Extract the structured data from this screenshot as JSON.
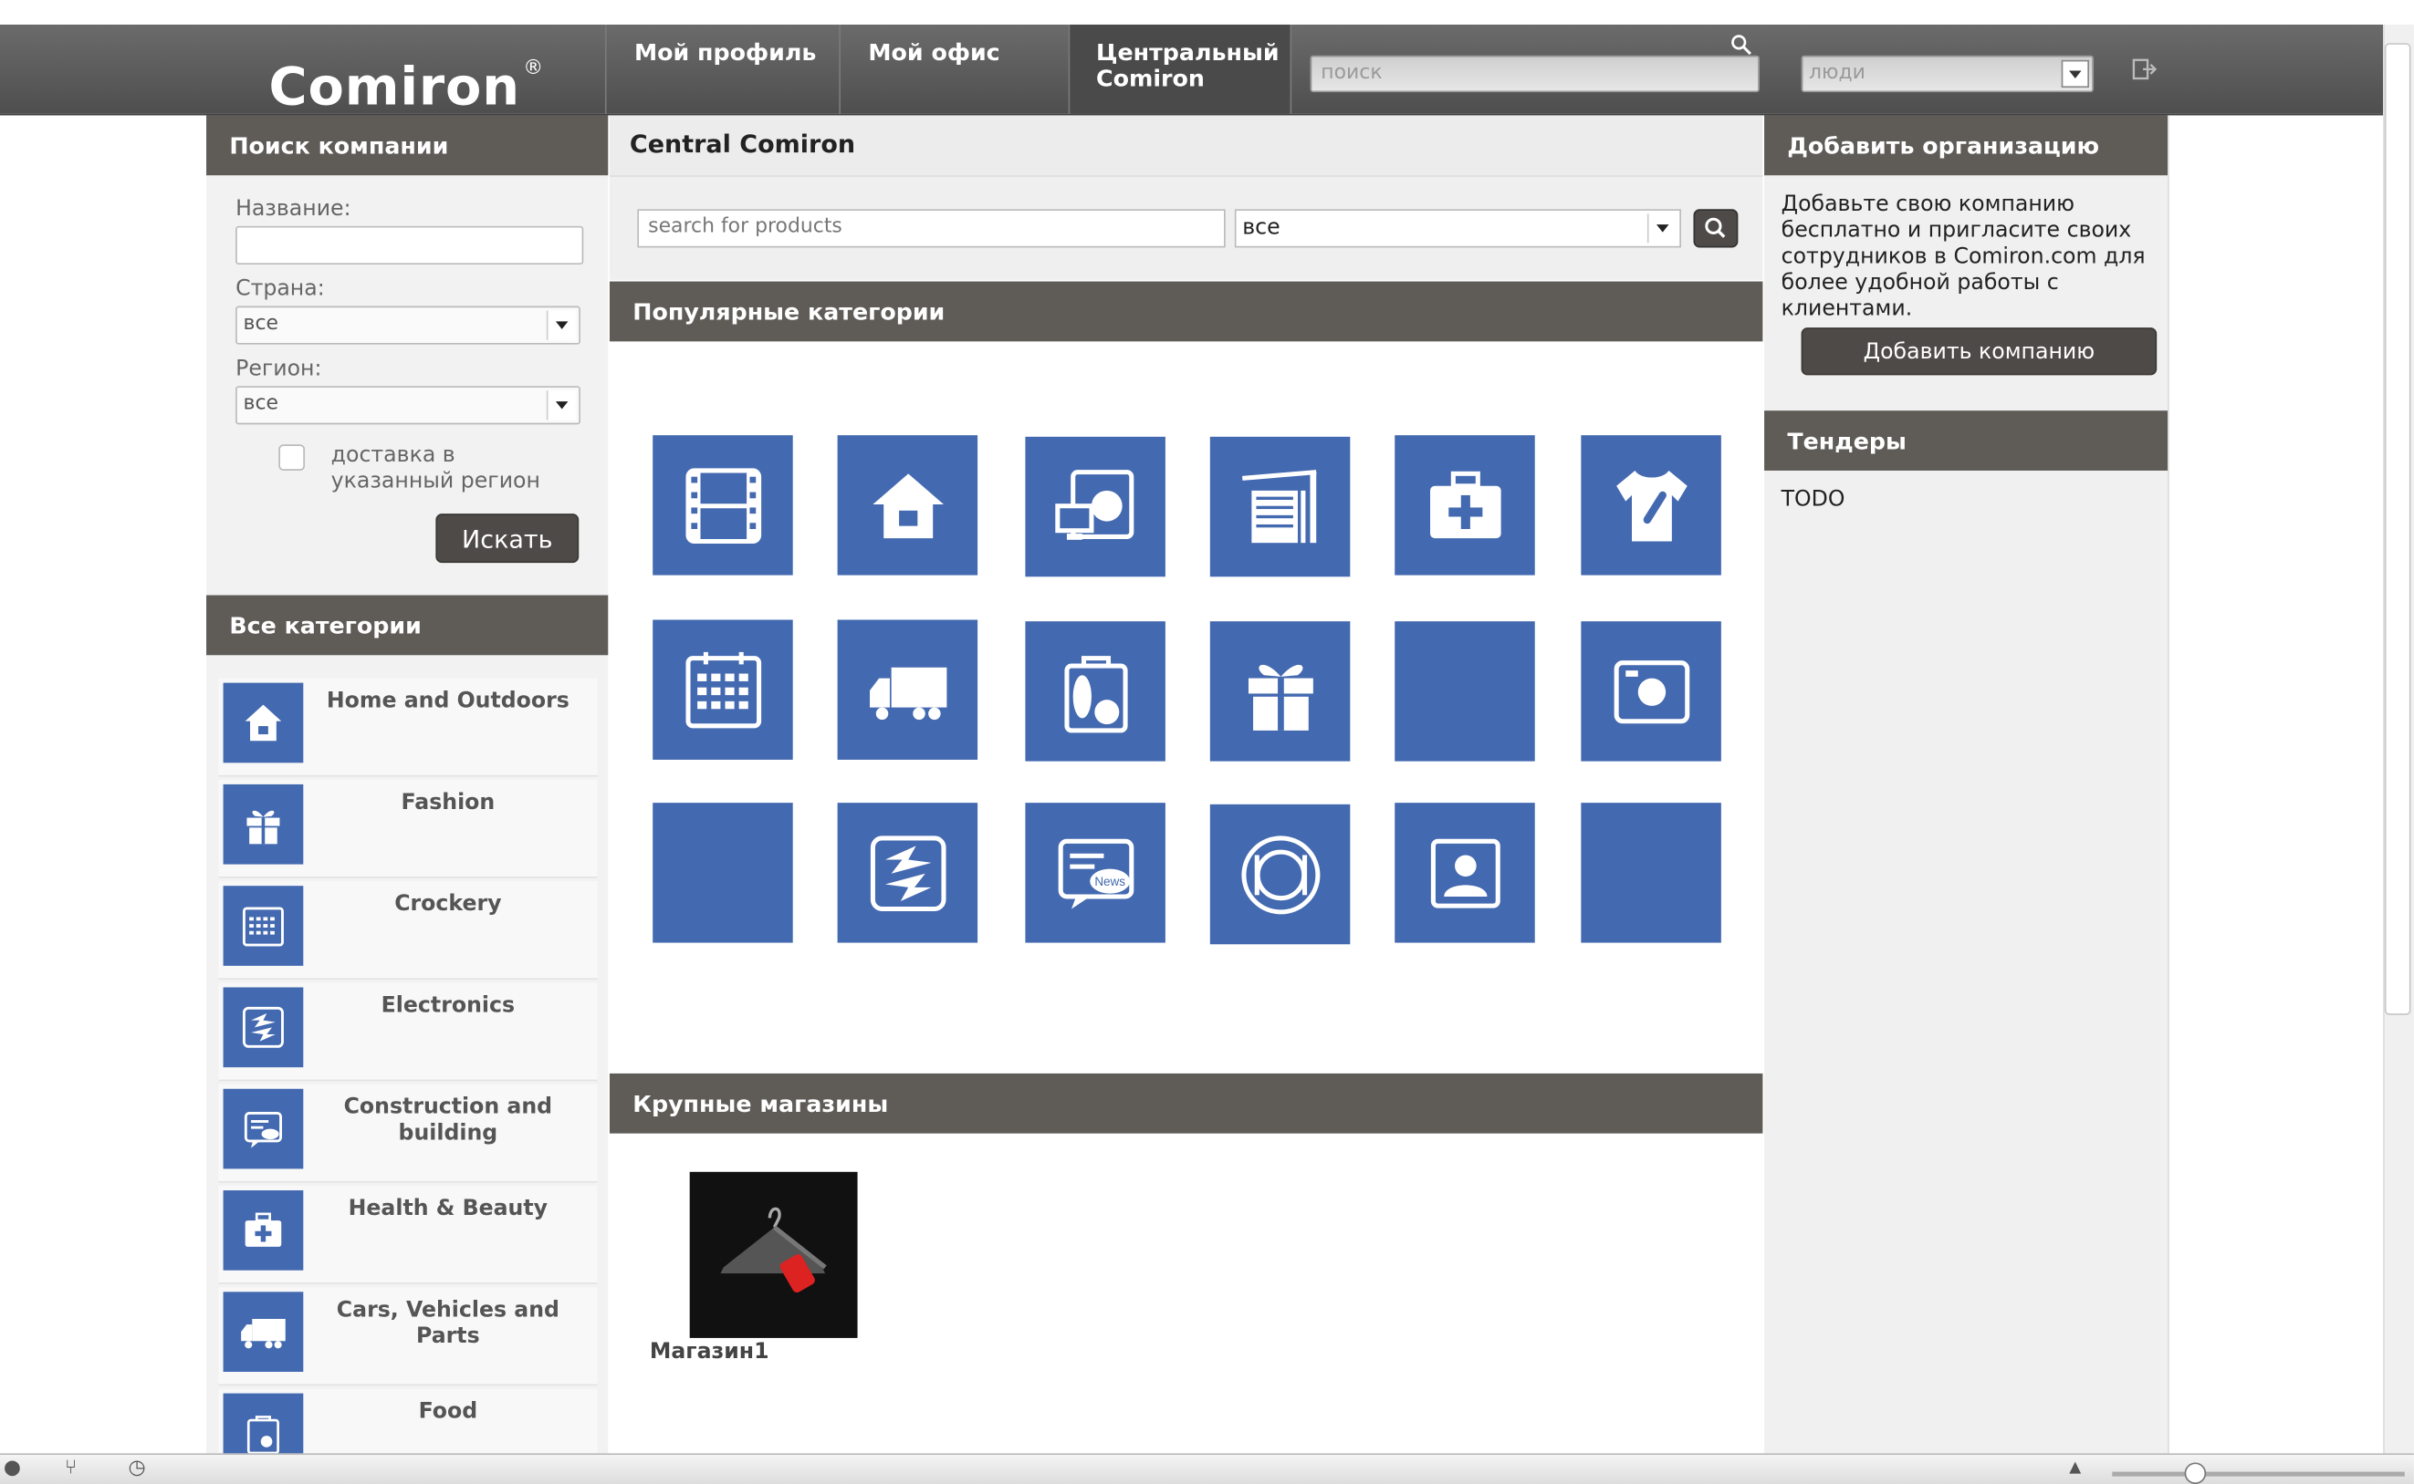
{
  "header": {
    "logo": "Comiron",
    "logo_mark": "®",
    "nav": [
      "Мой профиль",
      "Мой офис",
      "Центральный Comiron"
    ],
    "search_placeholder": "поиск",
    "people_select": "люди"
  },
  "left": {
    "search_title": "Поиск компании",
    "name_label": "Название:",
    "country_label": "Страна:",
    "country_value": "все",
    "region_label": "Регион:",
    "region_value": "все",
    "delivery_label": "доставка в указанный регион",
    "search_button": "Искать",
    "categories_title": "Все категории",
    "categories": [
      {
        "label": "Home and Outdoors",
        "icon": "house-icon"
      },
      {
        "label": "Fashion",
        "icon": "gift-icon"
      },
      {
        "label": "Crockery",
        "icon": "calendar-icon"
      },
      {
        "label": "Electronics",
        "icon": "recycle-icon"
      },
      {
        "label": "Construction and building",
        "icon": "news-icon"
      },
      {
        "label": "Health & Beauty",
        "icon": "medkit-icon"
      },
      {
        "label": "Cars, Vehicles and Parts",
        "icon": "truck-icon"
      },
      {
        "label": "Food",
        "icon": "grocery-bag-icon"
      }
    ]
  },
  "main": {
    "title": "Central Comiron",
    "search_placeholder": "search for products",
    "category_select": "все",
    "popular_title": "Популярные категории",
    "tiles": [
      "film-icon",
      "house-icon",
      "appliance-icon",
      "building-icon",
      "medkit-icon",
      "tshirt-icon",
      "calendar-icon",
      "truck-icon",
      "grocery-bag-icon",
      "gift-icon",
      "blank-tile",
      "camera-icon",
      "blank-tile",
      "recycle-icon",
      "news-icon",
      "plate-icon",
      "contact-icon",
      "blank-tile"
    ],
    "tile_news_text": "News",
    "shops_title": "Крупные магазины",
    "shops": [
      {
        "name": "Магазин1"
      }
    ]
  },
  "right": {
    "add_title": "Добавить организацию",
    "add_text": "Добавьте свою компанию бесплатно и пригласите своих сотрудников в Comiron.com для более удобной работы с клиентами.",
    "add_button": "Добавить компанию",
    "tenders_title": "Тендеры",
    "tenders_text": "TODO"
  },
  "colors": {
    "tile_blue": "#4369b0",
    "header_gray": "#5f5c58",
    "button_dark": "#4d4a47"
  }
}
